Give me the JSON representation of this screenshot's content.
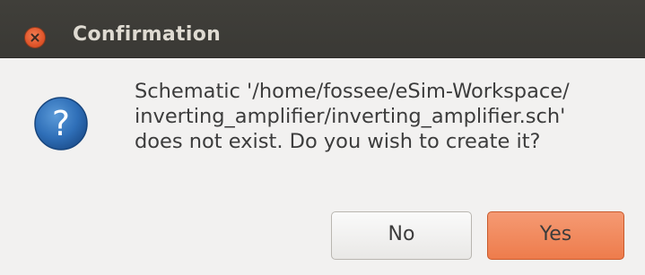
{
  "window": {
    "title": "Confirmation"
  },
  "dialog": {
    "icon": "question-icon",
    "message_lines": [
      "Schematic '/home/fossee/eSim-Workspace/",
      "inverting_amplifier/inverting_amplifier.sch'",
      "does not exist.  Do you wish to create it?"
    ],
    "buttons": {
      "no_label": "No",
      "yes_label": "Yes"
    }
  },
  "colors": {
    "titlebar": "#3c3b37",
    "close": "#e4572a",
    "accent_default_button": "#f07746",
    "dialog_bg": "#f2f1f0"
  }
}
